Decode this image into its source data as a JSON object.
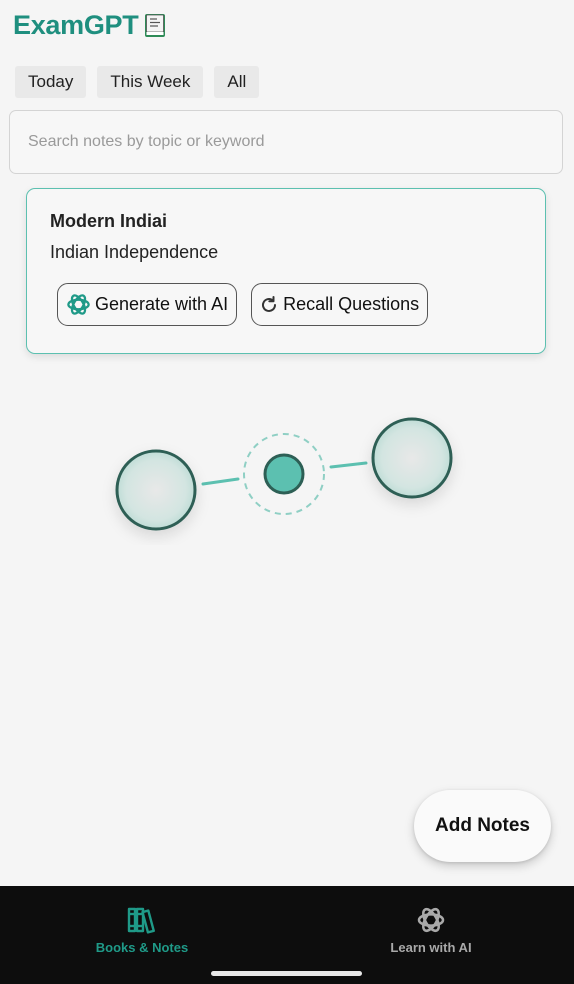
{
  "header": {
    "title": "ExamGPT",
    "title_color": "#1f8f7f",
    "emoji": "green-book-emoji"
  },
  "filters": [
    {
      "label": "Today"
    },
    {
      "label": "This Week"
    },
    {
      "label": "All"
    }
  ],
  "search": {
    "placeholder": "Search notes by topic or keyword",
    "value": ""
  },
  "note_card": {
    "subject": "Modern Indiai",
    "topic": "Indian Independence",
    "generate_label": "Generate with AI",
    "generate_icon": "openai-logo-icon",
    "recall_label": "Recall Questions",
    "recall_icon": "refresh-icon",
    "border_color": "#5cc0b0"
  },
  "illustration": {
    "accent": "#5cc0b0",
    "node_stroke": "#2d5f55"
  },
  "fab": {
    "label": "Add Notes"
  },
  "bottom_nav": {
    "items": [
      {
        "label": "Books & Notes",
        "icon": "books-icon",
        "active": true,
        "color": "#1f9a88"
      },
      {
        "label": "Learn with AI",
        "icon": "openai-logo-icon",
        "active": false,
        "color": "#a9a9a9"
      }
    ]
  }
}
